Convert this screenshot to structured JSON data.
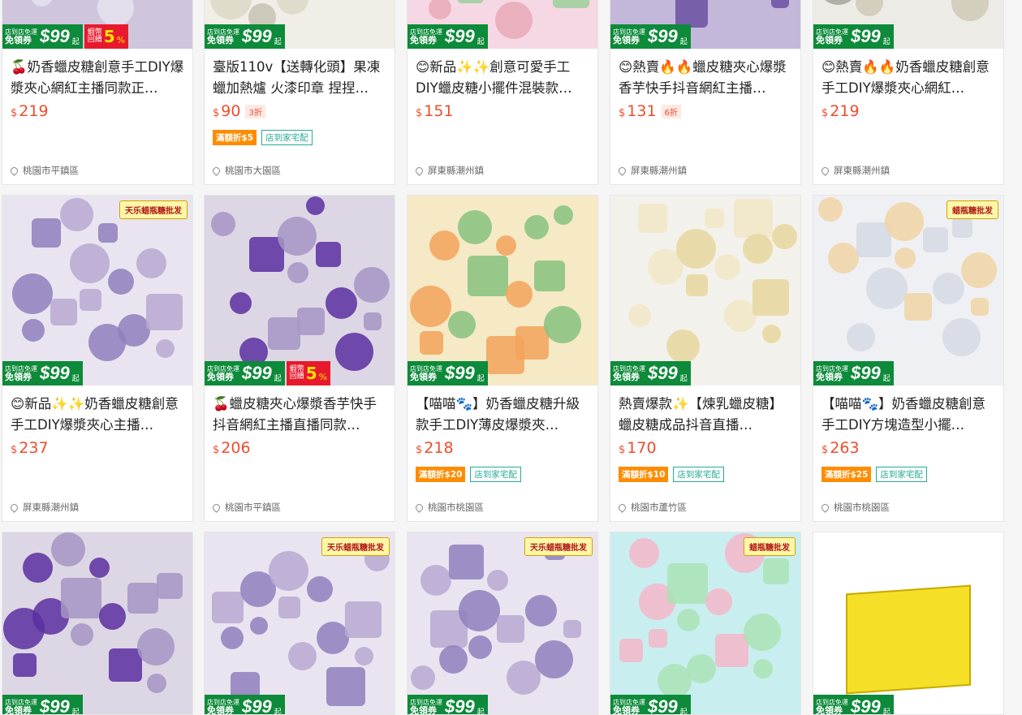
{
  "coupon": {
    "line1": "店到店免運",
    "line2": "免領券",
    "amount": "99",
    "suffix": "起"
  },
  "shopee_rebate": {
    "line1": "蝦幣",
    "line2": "回饋",
    "amount": "5",
    "pct": "%"
  },
  "watermarks": {
    "tianle": "天乐蜡瓶糖批发",
    "wax": "蜡瓶糖批发"
  },
  "colors": {
    "price": "#ee4d2d",
    "coupon_green": "#0d8a3a",
    "tag_orange": "#ff8c00",
    "tag_teal": "#26aa99"
  },
  "products": [
    {
      "title": "🍒奶香蠟皮糖創意手工DIY爆漿夾心網紅主播同款正…",
      "currency": "$",
      "price": "219",
      "discount": "",
      "tag_discount": "",
      "tag_ship": "",
      "location": "桃園市平鎮區",
      "rebate": true,
      "wm": "tianle"
    },
    {
      "title": "臺版110v【送轉化頭】果凍蠟加熱爐 火漆印章 捏捏…",
      "currency": "$",
      "price": "90",
      "discount": "3折",
      "tag_discount": "滿額折$5",
      "tag_ship": "店到家宅配",
      "location": "桃園市大園區",
      "rebate": false,
      "wm": ""
    },
    {
      "title": "😊新品✨✨創意可愛手工DIY蠟皮糖小擺件混裝款…",
      "currency": "$",
      "price": "151",
      "discount": "",
      "tag_discount": "",
      "tag_ship": "",
      "location": "屏東縣潮州鎮",
      "rebate": false,
      "wm": ""
    },
    {
      "title": "😊熱賣🔥🔥蠟皮糖夾心爆漿香芋快手抖音網紅主播…",
      "currency": "$",
      "price": "131",
      "discount": "6折",
      "tag_discount": "",
      "tag_ship": "",
      "location": "屏東縣潮州鎮",
      "rebate": false,
      "wm": ""
    },
    {
      "title": "😊熱賣🔥🔥奶香蠟皮糖創意手工DIY爆漿夾心網紅…",
      "currency": "$",
      "price": "219",
      "discount": "",
      "tag_discount": "",
      "tag_ship": "",
      "location": "屏東縣潮州鎮",
      "rebate": false,
      "wm": "tianle"
    },
    {
      "title": "😊新品✨✨奶香蠟皮糖創意手工DIY爆漿夾心主播…",
      "currency": "$",
      "price": "237",
      "discount": "",
      "tag_discount": "",
      "tag_ship": "",
      "location": "屏東縣潮州鎮",
      "rebate": false,
      "wm": "tianle"
    },
    {
      "title": "🍒蠟皮糖夾心爆漿香芋快手抖音網紅主播直播同款…",
      "currency": "$",
      "price": "206",
      "discount": "",
      "tag_discount": "",
      "tag_ship": "",
      "location": "桃園市平鎮區",
      "rebate": true,
      "wm": ""
    },
    {
      "title": "【喵喵🐾】奶香蠟皮糖升級款手工DIY薄皮爆漿夾…",
      "currency": "$",
      "price": "218",
      "discount": "",
      "tag_discount": "滿額折$20",
      "tag_ship": "店到家宅配",
      "location": "桃園市桃園區",
      "rebate": false,
      "wm": ""
    },
    {
      "title": "熱賣爆款✨【煉乳蠟皮糖】蠟皮糖成品抖音直播…",
      "currency": "$",
      "price": "170",
      "discount": "",
      "tag_discount": "滿額折$10",
      "tag_ship": "店到家宅配",
      "location": "桃園市蘆竹區",
      "rebate": false,
      "wm": ""
    },
    {
      "title": "【喵喵🐾】奶香蠟皮糖創意手工DIY方塊造型小擺…",
      "currency": "$",
      "price": "263",
      "discount": "",
      "tag_discount": "滿額折$25",
      "tag_ship": "店到家宅配",
      "location": "桃園市桃園區",
      "rebate": false,
      "wm": "wax"
    },
    {
      "title": "",
      "currency": "",
      "price": "",
      "discount": "",
      "tag_discount": "",
      "tag_ship": "",
      "location": "",
      "rebate": false,
      "wm": ""
    },
    {
      "title": "",
      "currency": "",
      "price": "",
      "discount": "",
      "tag_discount": "",
      "tag_ship": "",
      "location": "",
      "rebate": false,
      "wm": "tianle"
    },
    {
      "title": "",
      "currency": "",
      "price": "",
      "discount": "",
      "tag_discount": "",
      "tag_ship": "",
      "location": "",
      "rebate": false,
      "wm": "tianle"
    },
    {
      "title": "",
      "currency": "",
      "price": "",
      "discount": "",
      "tag_discount": "",
      "tag_ship": "",
      "location": "",
      "rebate": false,
      "wm": "wax"
    },
    {
      "title": "",
      "currency": "",
      "price": "",
      "discount": "",
      "tag_discount": "",
      "tag_ship": "",
      "location": "",
      "rebate": false,
      "wm": ""
    }
  ]
}
